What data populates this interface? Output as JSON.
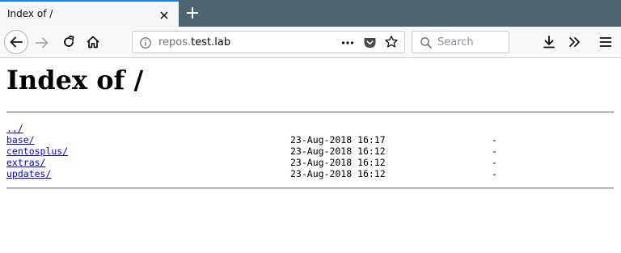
{
  "browser": {
    "tab": {
      "title": "Index of /"
    },
    "urlbar": {
      "prefix": "repos.",
      "host": "test.lab"
    },
    "search": {
      "placeholder": "Search"
    },
    "icons": {
      "back": "arrow-left-icon",
      "forward": "arrow-right-icon",
      "reload": "reload-icon",
      "home": "home-icon",
      "info": "info-icon",
      "page_actions": "ellipsis-icon",
      "pocket": "pocket-icon",
      "bookmark": "star-icon",
      "search": "magnifier-icon",
      "downloads": "download-icon",
      "overflow": "double-chevron-icon",
      "menu": "hamburger-icon",
      "close_tab": "close-icon",
      "new_tab": "plus-icon"
    },
    "colors": {
      "tabstrip": "#4f6471",
      "active_tab": "#f5f6f7",
      "tab_accent": "#0a84ff",
      "toolbar": "#f9f9fa",
      "link": "#0000ee"
    }
  },
  "page": {
    "heading": "Index of /",
    "entries": [
      {
        "name": "../",
        "date": "",
        "size": ""
      },
      {
        "name": "base/",
        "date": "23-Aug-2018 16:17",
        "size": "-"
      },
      {
        "name": "centosplus/",
        "date": "23-Aug-2018 16:12",
        "size": "-"
      },
      {
        "name": "extras/",
        "date": "23-Aug-2018 16:12",
        "size": "-"
      },
      {
        "name": "updates/",
        "date": "23-Aug-2018 16:12",
        "size": "-"
      }
    ]
  }
}
